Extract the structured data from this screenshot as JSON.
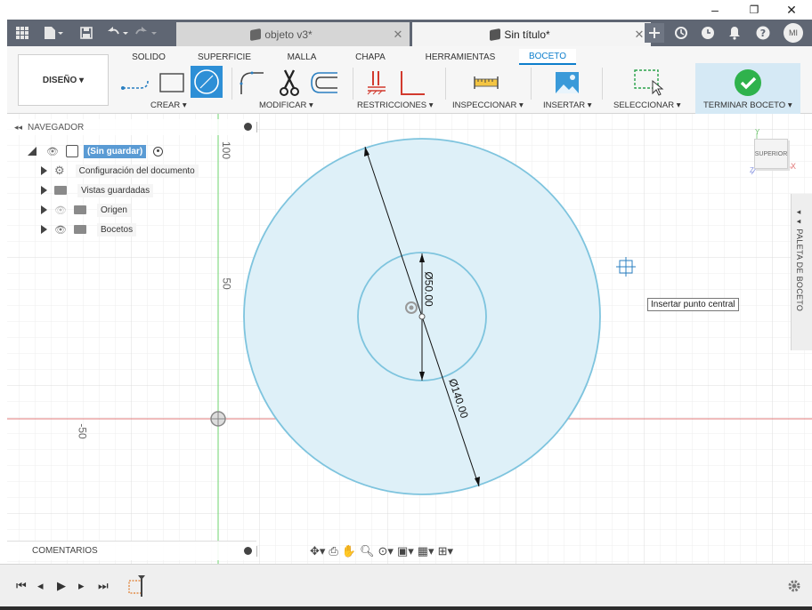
{
  "window": {
    "minimize_glyph": "–",
    "restore_glyph": "❐",
    "close_glyph": "✕"
  },
  "tabs": [
    {
      "title": "objeto v3*",
      "close": "✕",
      "active": false
    },
    {
      "title": "Sin título*",
      "close": "✕",
      "active": true
    }
  ],
  "user": {
    "initials": "MI"
  },
  "ribbon": {
    "workspace": "DISEÑO ▾",
    "tabs": [
      "SOLIDO",
      "SUPERFICIE",
      "MALLA",
      "CHAPA",
      "HERRAMIENTAS",
      "BOCETO"
    ],
    "active_tab": "BOCETO",
    "groups": {
      "crear": "CREAR ▾",
      "modificar": "MODIFICAR ▾",
      "restricciones": "RESTRICCIONES ▾",
      "inspeccionar": "INSPECCIONAR ▾",
      "insertar": "INSERTAR ▾",
      "seleccionar": "SELECCIONAR ▾",
      "terminar": "TERMINAR BOCETO ▾"
    },
    "accent_color": "#0d7ecc"
  },
  "navigator": {
    "title": "NAVEGADOR",
    "root": "(Sin guardar)",
    "items": [
      {
        "label": "Configuración del documento",
        "icon": "gear-icon"
      },
      {
        "label": "Vistas guardadas",
        "icon": "folder-icon"
      },
      {
        "label": "Origen",
        "icon": "folder-icon",
        "hidden": true
      },
      {
        "label": "Bocetos",
        "icon": "folder-icon"
      }
    ]
  },
  "viewport": {
    "ruler_labels": {
      "v100": "100",
      "v50": "50",
      "h_neg50": "-50"
    },
    "dimensions": {
      "inner": "Ø50.00",
      "outer": "Ø140.00"
    },
    "viewcube_label": "SUPERIOR",
    "axis_labels": {
      "y": "Y",
      "x": "X",
      "z": "Z"
    },
    "tooltip": "Insertar punto central",
    "sketch_palette": "◂◂ PALETA DE BOCETO",
    "circle_color": "#7ec4de",
    "fill_color": "#def0f8"
  },
  "comments": {
    "title": "COMENTARIOS"
  },
  "timeline": {
    "buttons": [
      "⏮",
      "◂",
      "▶",
      "▸",
      "⏭"
    ]
  }
}
